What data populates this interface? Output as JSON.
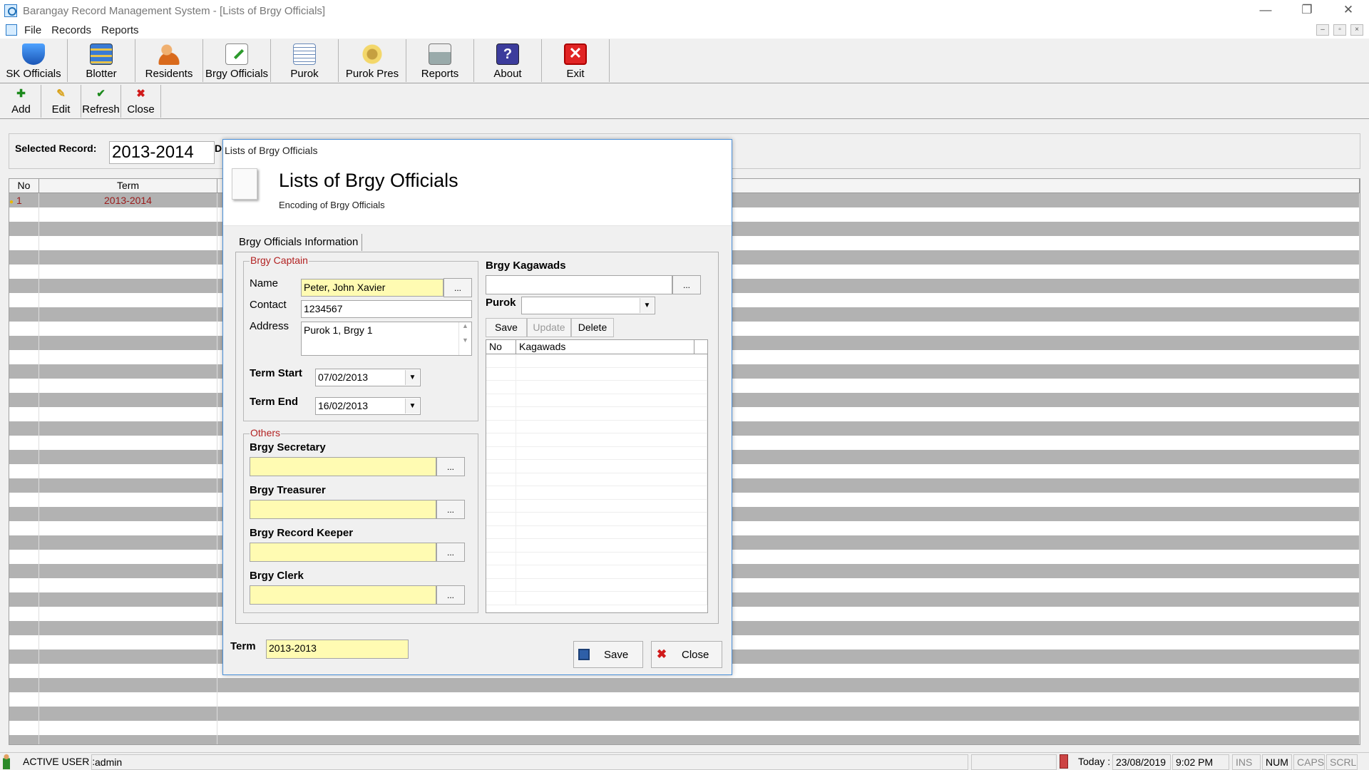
{
  "window": {
    "title": "Barangay Record Management System - [Lists of Brgy Officials]",
    "minimize": "—",
    "restore": "❐",
    "close": "✕"
  },
  "menu": [
    "File",
    "Records",
    "Reports"
  ],
  "mdi_controls": [
    "–",
    "▫",
    "×"
  ],
  "toolbar": [
    {
      "label": "SK Officials",
      "icon": "shield-icon"
    },
    {
      "label": "Blotter",
      "icon": "blotter-icon"
    },
    {
      "label": "Residents",
      "icon": "residents-icon"
    },
    {
      "label": "Brgy Officials",
      "icon": "officials-icon"
    },
    {
      "label": "Purok",
      "icon": "purok-icon"
    },
    {
      "label": "Purok Pres",
      "icon": "purok-pres-icon"
    },
    {
      "label": "Reports",
      "icon": "printer-icon"
    },
    {
      "label": "About",
      "icon": "help-icon"
    },
    {
      "label": "Exit",
      "icon": "exit-icon"
    }
  ],
  "toolbar2": [
    {
      "label": "Add",
      "icon": "add-icon",
      "glyph": "✚"
    },
    {
      "label": "Edit",
      "icon": "pencil-icon",
      "glyph": "✎"
    },
    {
      "label": "Refresh",
      "icon": "check-icon",
      "glyph": "✔"
    },
    {
      "label": "Close",
      "icon": "close-icon",
      "glyph": "✖"
    }
  ],
  "record_panel": {
    "label": "Selected Record:",
    "value": "2013-2014",
    "label2": "D"
  },
  "grid": {
    "headers": [
      "No",
      "Term"
    ],
    "rows": [
      {
        "no": "1",
        "term": "2013-2014"
      }
    ]
  },
  "dialog": {
    "title": "Lists of Brgy Officials",
    "heading": "Lists of Brgy Officials",
    "subheading": "Encoding of Brgy Officials",
    "tab": "Brgy Officials Information",
    "captain": {
      "group_title": "Brgy Captain",
      "name_label": "Name",
      "name_value": "Peter, John Xavier",
      "contact_label": "Contact",
      "contact_value": "1234567",
      "address_label": "Address",
      "address_value": "Purok 1, Brgy 1",
      "term_start_label": "Term Start",
      "term_start_value": "07/02/2013",
      "term_end_label": "Term End",
      "term_end_value": "16/02/2013"
    },
    "others": {
      "group_title": "Others",
      "secretary_label": "Brgy Secretary",
      "treasurer_label": "Brgy Treasurer",
      "record_keeper_label": "Brgy Record Keeper",
      "clerk_label": "Brgy Clerk",
      "dots": "..."
    },
    "kagawads": {
      "label": "Brgy Kagawads",
      "purok_label": "Purok",
      "save": "Save",
      "update": "Update",
      "delete": "Delete",
      "list_headers": [
        "No",
        "Kagawads"
      ]
    },
    "term_label": "Term",
    "term_value": "2013-2013",
    "save_button": "Save",
    "close_button": "Close"
  },
  "status": {
    "active_user_label": "ACTIVE USER :",
    "active_user": "admin",
    "today_label": "Today :",
    "date": "23/08/2019",
    "time": "9:02 PM",
    "ins": "INS",
    "num": "NUM",
    "caps": "CAPS",
    "scrl": "SCRL"
  }
}
